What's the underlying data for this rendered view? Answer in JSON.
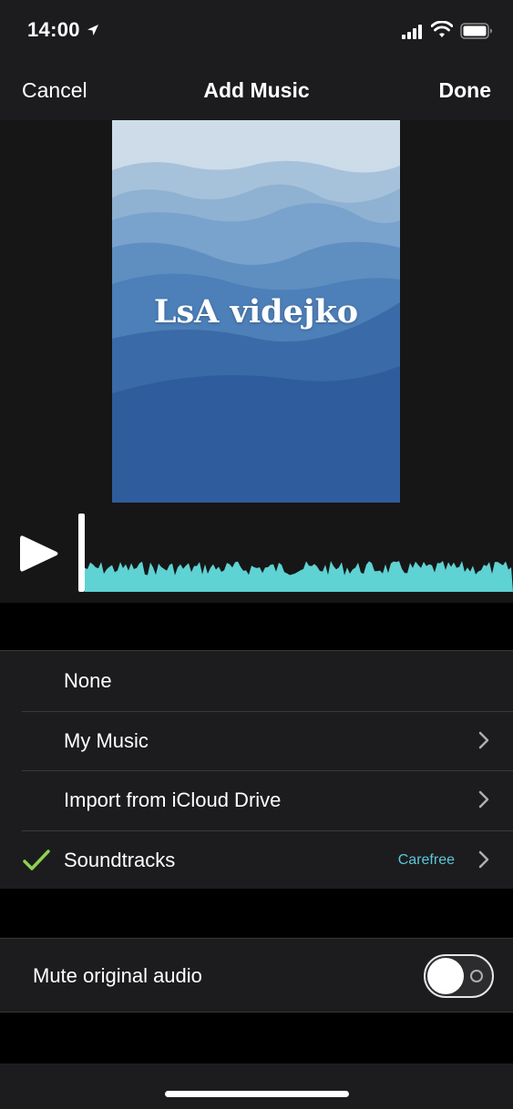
{
  "status_bar": {
    "time": "14:00",
    "icons": [
      "location-arrow-icon",
      "cellular-signal-icon",
      "wifi-icon",
      "battery-icon"
    ]
  },
  "nav": {
    "cancel_label": "Cancel",
    "title": "Add Music",
    "done_label": "Done"
  },
  "preview": {
    "poster_title": "LsA videjko",
    "play_icon": "play-icon",
    "waveform_color": "#5fd2d3"
  },
  "music_sources": [
    {
      "label": "None",
      "checked": false,
      "has_chevron": false
    },
    {
      "label": "My Music",
      "checked": false,
      "has_chevron": true
    },
    {
      "label": "Import from iCloud Drive",
      "checked": false,
      "has_chevron": true
    },
    {
      "label": "Soundtracks",
      "checked": true,
      "has_chevron": true,
      "detail": "Carefree"
    }
  ],
  "mute": {
    "label": "Mute original audio",
    "enabled": false
  },
  "colors": {
    "accent_check": "#8ed14f",
    "detail_text": "#5ac8d8",
    "background": "#000000",
    "panel": "#1c1c1e"
  }
}
